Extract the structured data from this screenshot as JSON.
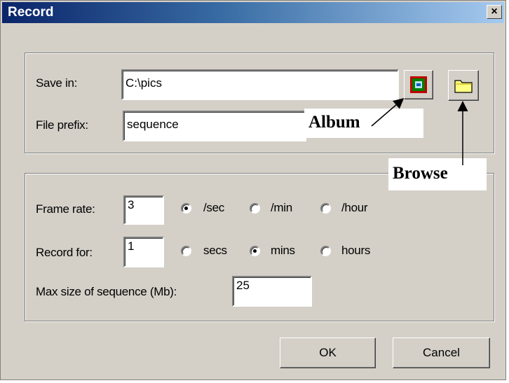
{
  "window": {
    "title": "Record",
    "close_label": "×"
  },
  "save_group": {
    "save_in_label": "Save in:",
    "save_in_value": "C:\\pics",
    "file_prefix_label": "File prefix:",
    "file_prefix_value": "sequence",
    "album_icon": "album-icon",
    "browse_icon": "folder-icon"
  },
  "record_group": {
    "frame_rate_label": "Frame rate:",
    "frame_rate_value": "3",
    "rate_options": [
      "/sec",
      "/min",
      "/hour"
    ],
    "rate_selected": "/sec",
    "record_for_label": "Record for:",
    "record_for_value": "1",
    "duration_options": [
      "secs",
      "mins",
      "hours"
    ],
    "duration_selected": "mins",
    "max_size_label": "Max size of sequence (Mb):",
    "max_size_value": "25"
  },
  "buttons": {
    "ok": "OK",
    "cancel": "Cancel"
  },
  "annotations": {
    "album": "Album",
    "browse": "Browse"
  },
  "colors": {
    "dialog_bg": "#d4d0c8",
    "title_start": "#0a246a",
    "title_end": "#a6caf0"
  }
}
